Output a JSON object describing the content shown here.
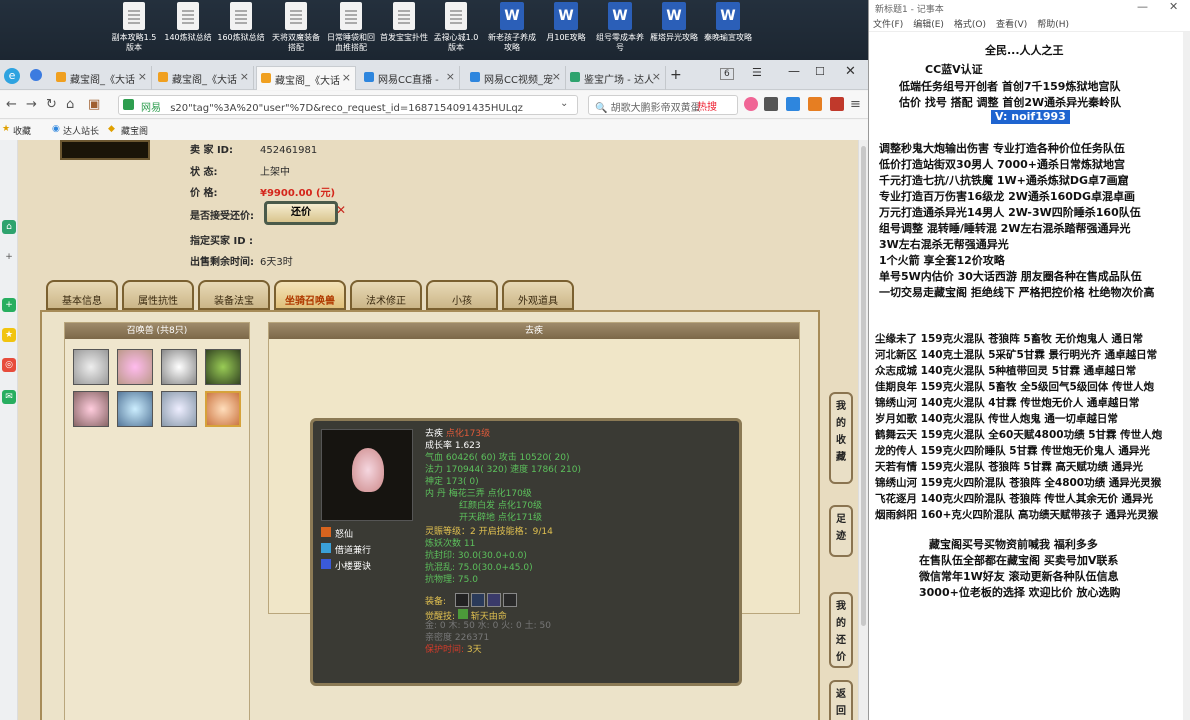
{
  "desktop": {
    "icons": [
      {
        "label": "副本攻略1.5版本",
        "type": "doc"
      },
      {
        "label": "140炼狱总结",
        "type": "doc"
      },
      {
        "label": "160炼狱总结",
        "type": "doc"
      },
      {
        "label": "天将双魔装备搭配",
        "type": "doc"
      },
      {
        "label": "日常睡袋和回血推搭配",
        "type": "doc"
      },
      {
        "label": "首发宝宝扑性",
        "type": "doc"
      },
      {
        "label": "孟禄心城1.0版本",
        "type": "doc"
      },
      {
        "label": "新老孩子养成攻略",
        "type": "word"
      },
      {
        "label": "月10E攻略",
        "type": "word"
      },
      {
        "label": "组号零成本养号",
        "type": "word"
      },
      {
        "label": "雁塔异光攻略",
        "type": "word"
      },
      {
        "label": "秦晚瑜宣攻略",
        "type": "word"
      }
    ]
  },
  "browser": {
    "tabs": [
      {
        "label": "藏宝阁_《大话"
      },
      {
        "label": "藏宝阁_《大话"
      },
      {
        "label": "藏宝阁_《大话"
      },
      {
        "label": "网易CC直播 -"
      },
      {
        "label": "网易CC视频_宠"
      },
      {
        "label": "鉴宝广场 - 达人"
      }
    ],
    "tab_count": "6",
    "url": "s20\"tag\"%3A%20\"user\"%7D&reco_request_id=1687154091435HULqz",
    "site_label": "网易",
    "search_text": "胡歌大鹏影帝双黄蛋",
    "hot_label": "热搜",
    "bookmarks": [
      "收藏",
      "达人站长",
      "藏宝阁"
    ]
  },
  "item": {
    "seller_label": "卖 家 ID:",
    "seller_id": "452461981",
    "status_label": "状 态:",
    "status": "上架中",
    "price_label": "价 格:",
    "price": "¥9900.00 (元)",
    "bargain_label": "是否接受还价:",
    "bargain_button": "还价",
    "buyer_label": "指定买家 ID :",
    "remain_label": "出售剩余时间:",
    "remain": "6天3时"
  },
  "game_tabs": [
    "基本信息",
    "属性抗性",
    "装备法宝",
    "坐骑召唤兽",
    "法术修正",
    "小孩",
    "外观道具"
  ],
  "summon": {
    "list_title": "召唤兽 (共8只)",
    "detail_title": "去疾",
    "name": "去疾",
    "level": "点化173级",
    "growth": "成长率 1.623",
    "hp": "气血 60426( 60) 攻击 10520( 20)",
    "mp": "法力 170944( 320) 速度 1786( 210)",
    "shen": "神定 173( 0)",
    "dan_label": "内    丹",
    "dan1": "梅花三弄 点化170级",
    "dan2": "红颜白发 点化170级",
    "dan3": "开天辟地 点化171级",
    "skills": [
      "怒仙",
      "借道兼行",
      "小楼要诀"
    ],
    "linghou": "灵賑等级：2 开启技能格：9/14",
    "lianyao": "炼妖次数 11",
    "kangyin": "抗封印: 30.0(30.0+0.0)",
    "kanghun": "抗混乱: 75.0(30.0+45.0)",
    "kangwu": "抗物理: 75.0",
    "equip_label": "装备:",
    "awaken_label": "觉醒技:",
    "awaken": "斩天由命",
    "elements": "金: 0 木: 50 水: 0 火: 0 土: 50",
    "intimacy": "亲密度 226371",
    "protect_label": "保护时间:",
    "protect": "3天"
  },
  "side_buttons": [
    "我的收藏",
    "足迹",
    "我的还价",
    "返回顶部"
  ],
  "notepad": {
    "title": "新标题1 - 记事本",
    "menu": [
      "文件(F)",
      "编辑(E)",
      "格式(O)",
      "查看(V)",
      "帮助(H)"
    ],
    "lines": [
      "全民...人人之王",
      "CC蓝V认证",
      "低端任务组号开创者     首创7千159炼狱地宫队",
      "估价 找号 搭配 调整     首创2W通杀异光秦岭队",
      "V: noif1993",
      "调整秒鬼大炮输出伤害          专业打造各种价位任务队伍",
      "低价打造站街双30男人           7000+通杀日常炼狱地宫",
      "千元打造七抗/八抗铁魔          1W+通杀炼狱DG卓7画窟",
      "专业打造百万伤害16级龙          2W通杀160DG卓混卓画",
      "万元打造通杀异光14男人        2W-3W四阶睡杀160队伍",
      "组号调整 混转睡/睡转混           2W左右混杀踏帮强通异光",
      "                                    3W左右混杀无帮强通异光",
      "1个火箭 享全套12价攻略",
      "单号5W内估价 30大话西游      朋友圈各种在售成品队伍",
      "一切交易走藏宝阁 拒绝线下    严格把控价格 杜绝物次价高",
      "尘缘未了 159克火混队 苍狼阵 5畜牧 无价炮鬼人 通日常",
      "河北新区 140克土混队 5采矿5甘霖 景行明光齐 通卓越日常",
      "众志成城 140克火混队 5种植带回灵 5甘霖 通卓越日常",
      "佳期良年 159克火混队 5畜牧 全5级回气5级回体 传世人炮",
      "锦绣山河 140克火混队 4甘霖 传世炮无价人 通卓越日常",
      "岁月如歌 140克火混队 传世人炮鬼 通一切卓越日常",
      "鹤舞云天 159克火混队 全60天赋4800功绩 5甘霖 传世人炮",
      "龙的传人 159克火四阶睡队 5甘霖 传世炮无价鬼人 通异光",
      "天若有情 159克火混队 苍狼阵 5甘霖 高天赋功绩 通异光",
      "锦绣山河 159克火四阶混队 苍狼阵 全4800功绩 通异光灵猴",
      "飞花逐月 140克火四阶混队 苍狼阵 传世人其余无价 通异光",
      "烟雨斜阳 160+克火四阶混队 高功绩天赋带孩子 通异光灵猴",
      "藏宝阁买号买物资前喊我 福利多多",
      "在售队伍全部都在藏宝阁 买卖号加V联系",
      "微信常年1W好友 滚动更新各种队伍信息",
      "3000+位老板的选择 欢迎比价 放心选购"
    ]
  },
  "colors": {
    "accent": "#c8281e",
    "price": "#d4261b",
    "panel": "#ece3c9",
    "tab_active": "#b03a00"
  }
}
